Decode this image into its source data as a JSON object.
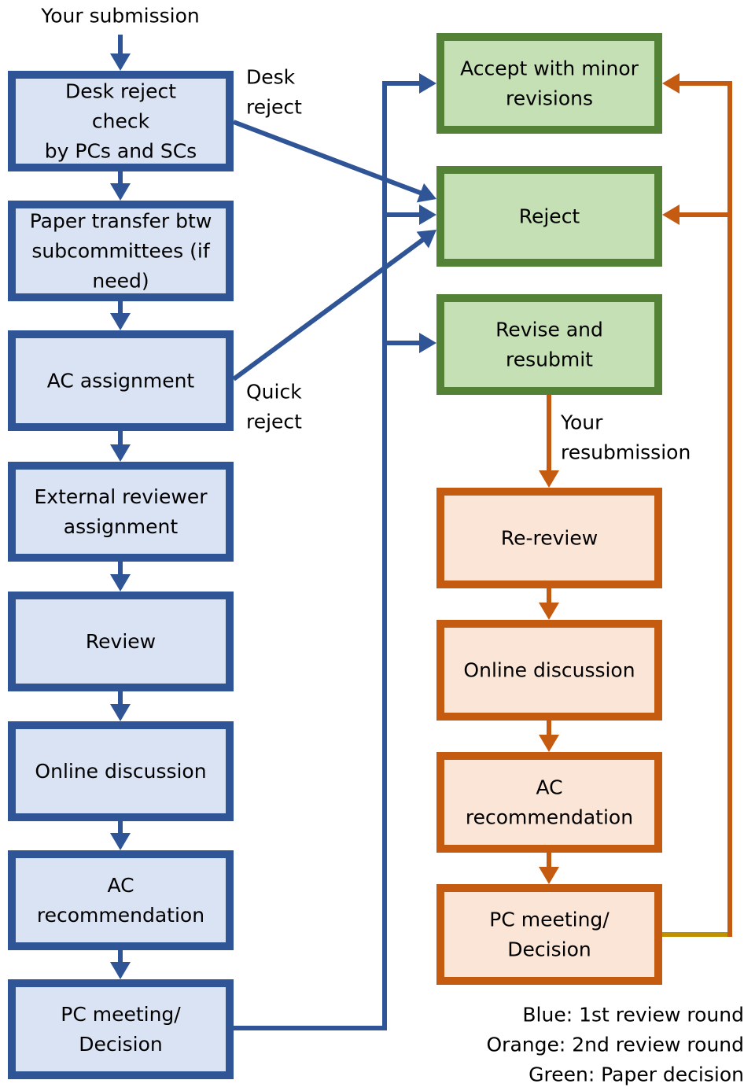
{
  "colors": {
    "blue_stroke": "#2F5597",
    "blue_fill": "#DAE3F3",
    "green_stroke": "#538135",
    "green_fill": "#C5E0B4",
    "orange_stroke": "#C55A11",
    "orange_fill": "#FBE5D6",
    "gold_connector": "#BF9000"
  },
  "start_label": "Your submission",
  "first_round": [
    {
      "id": "desk-reject-check",
      "lines": [
        "Desk reject",
        "check",
        "by PCs and SCs"
      ]
    },
    {
      "id": "paper-transfer",
      "lines": [
        "Paper transfer btw",
        "subcommittees (if",
        "need)"
      ]
    },
    {
      "id": "ac-assignment",
      "lines": [
        "AC assignment"
      ]
    },
    {
      "id": "external-reviewer-assignment",
      "lines": [
        "External reviewer",
        "assignment"
      ]
    },
    {
      "id": "review",
      "lines": [
        "Review"
      ]
    },
    {
      "id": "online-discussion",
      "lines": [
        "Online discussion"
      ]
    },
    {
      "id": "ac-recommendation",
      "lines": [
        "AC",
        "recommendation"
      ]
    },
    {
      "id": "pc-meeting-decision",
      "lines": [
        "PC meeting/",
        "Decision"
      ]
    }
  ],
  "decisions": [
    {
      "id": "accept-minor-revisions",
      "lines": [
        "Accept with minor",
        "revisions"
      ]
    },
    {
      "id": "reject",
      "lines": [
        "Reject"
      ]
    },
    {
      "id": "revise-resubmit",
      "lines": [
        "Revise and",
        "resubmit"
      ]
    }
  ],
  "second_round": [
    {
      "id": "re-review",
      "lines": [
        "Re-review"
      ]
    },
    {
      "id": "online-discussion-2",
      "lines": [
        "Online discussion"
      ]
    },
    {
      "id": "ac-recommendation-2",
      "lines": [
        "AC",
        "recommendation"
      ]
    },
    {
      "id": "pc-meeting-decision-2",
      "lines": [
        "PC meeting/",
        "Decision"
      ]
    }
  ],
  "edge_labels": {
    "desk_reject": [
      "Desk",
      "reject"
    ],
    "quick_reject": [
      "Quick",
      "reject"
    ],
    "resubmission": [
      "Your",
      "resubmission"
    ]
  },
  "legend": [
    "Blue: 1st review round",
    "Orange: 2nd review round",
    "Green: Paper decision"
  ]
}
